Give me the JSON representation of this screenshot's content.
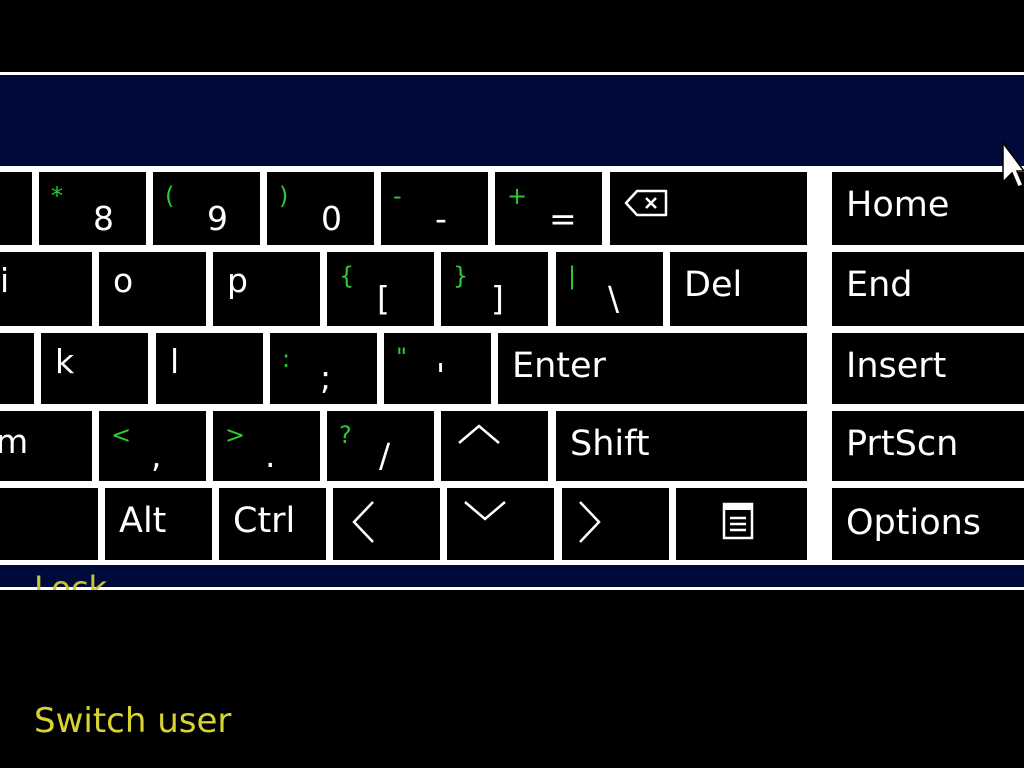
{
  "colors": {
    "panel": "#000a3a",
    "key_bg": "#000000",
    "key_text": "#ffffff",
    "shift_legend": "#2ec92e",
    "menu_text": "#d9d332"
  },
  "keyboard": {
    "row1": [
      {
        "shift": "*",
        "main": "8"
      },
      {
        "shift": "(",
        "main": "9"
      },
      {
        "shift": ")",
        "main": "0"
      },
      {
        "shift": "-",
        "main": "-"
      },
      {
        "shift": "+",
        "main": "="
      },
      {
        "icon": "backspace-icon"
      }
    ],
    "row2": [
      {
        "main": "i"
      },
      {
        "main": "o"
      },
      {
        "main": "p"
      },
      {
        "shift": "{",
        "main": "["
      },
      {
        "shift": "}",
        "main": "]"
      },
      {
        "shift": "|",
        "main": "\\"
      },
      {
        "label": "Del"
      }
    ],
    "row3": [
      {
        "main": "k"
      },
      {
        "main": "l"
      },
      {
        "shift": ":",
        "main": ";"
      },
      {
        "shift": "\"",
        "main": "'"
      },
      {
        "label": "Enter"
      }
    ],
    "row4": [
      {
        "main": "m"
      },
      {
        "shift": "<",
        "main": ","
      },
      {
        "shift": ">",
        "main": "."
      },
      {
        "shift": "?",
        "main": "/"
      },
      {
        "icon": "arrow-up-icon"
      },
      {
        "label": "Shift"
      }
    ],
    "row5": [
      {
        "label": "Alt"
      },
      {
        "label": "Ctrl"
      },
      {
        "icon": "arrow-left-icon"
      },
      {
        "icon": "arrow-down-icon"
      },
      {
        "icon": "arrow-right-icon"
      },
      {
        "icon": "context-menu-icon"
      }
    ],
    "side": [
      {
        "label": "Home"
      },
      {
        "label": "End"
      },
      {
        "label": "Insert"
      },
      {
        "label": "PrtScn"
      },
      {
        "label": "Options"
      }
    ]
  },
  "menu": {
    "lock": "Lock",
    "switch_user": "Switch user"
  }
}
